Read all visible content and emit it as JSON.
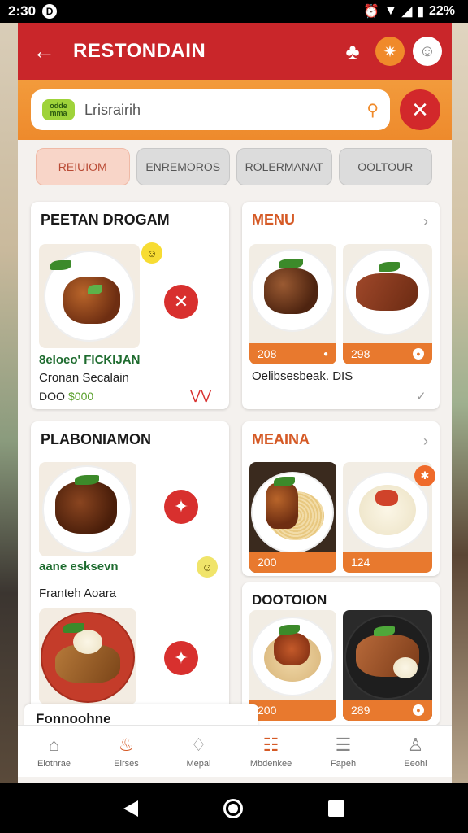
{
  "status_bar": {
    "time": "2:30",
    "badge": "D",
    "battery_text": "22%"
  },
  "top_bar": {
    "title": "RESTONDAIN"
  },
  "search": {
    "logo_text": "odde mma",
    "value": "Lrisrairih"
  },
  "tabs": [
    {
      "label": "REIUIOM",
      "active": true
    },
    {
      "label": "ENREMOROS",
      "active": false
    },
    {
      "label": "ROLERMANAT",
      "active": false
    },
    {
      "label": "OOLTOUR",
      "active": false
    }
  ],
  "card_left_1": {
    "title": "PEETAN DROGAM",
    "name_green": "8eIoeo' FICKIJAN",
    "subtitle": "Cronan Secalain",
    "price_prefix": "DOO",
    "price": "$000"
  },
  "card_right_1": {
    "title": "MENU",
    "price_a": "208",
    "price_b": "298",
    "caption": "Oelibsesbeak.  DIS"
  },
  "card_left_2": {
    "title": "PLABONIAMON",
    "name_green": "aane esksevn",
    "subtitle": "Franteh Aoara"
  },
  "card_right_2": {
    "title": "MEAINA",
    "price_a": "200",
    "price_b": "124"
  },
  "card_right_3": {
    "title": "DOOTOION",
    "price_a": "200",
    "price_b": "289"
  },
  "floating_label": "Fonnoohne",
  "bottom_nav": [
    {
      "label": "Eiotnrae",
      "icon": "home-icon"
    },
    {
      "label": "Eirses",
      "icon": "food-icon",
      "active": true
    },
    {
      "label": "Mepal",
      "icon": "bag-icon"
    },
    {
      "label": "Mbdenkee",
      "icon": "menu-icon"
    },
    {
      "label": "Fapeh",
      "icon": "list-icon"
    },
    {
      "label": "Eeohi",
      "icon": "profile-icon"
    }
  ],
  "colors": {
    "primary_red": "#c9262a",
    "accent_orange": "#ee8a2c",
    "price_orange": "#e8792e"
  }
}
